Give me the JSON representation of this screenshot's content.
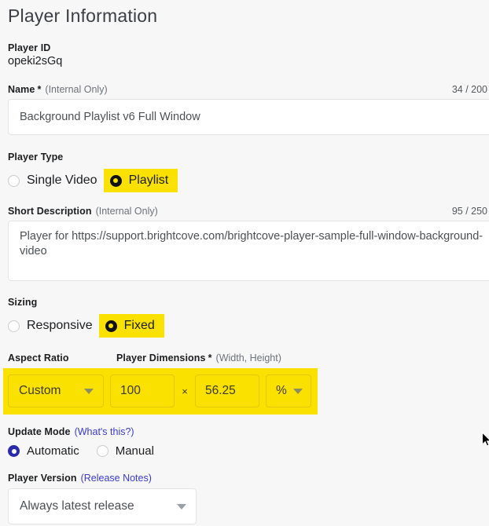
{
  "page": {
    "title": "Player Information"
  },
  "player_id": {
    "label": "Player ID",
    "value": "opeki2sGq"
  },
  "name": {
    "label": "Name",
    "required": "*",
    "sub": "(Internal Only)",
    "counter": "34 / 200",
    "value": "Background Playlist v6 Full Window"
  },
  "player_type": {
    "label": "Player Type",
    "options": [
      {
        "label": "Single Video",
        "selected": false,
        "highlighted": false
      },
      {
        "label": "Playlist",
        "selected": true,
        "highlighted": true
      }
    ]
  },
  "short_description": {
    "label": "Short Description",
    "sub": "(Internal Only)",
    "counter": "95 / 250",
    "value": "Player for https://support.brightcove.com/brightcove-player-sample-full-window-background-video"
  },
  "sizing": {
    "label": "Sizing",
    "options": [
      {
        "label": "Responsive",
        "selected": false,
        "highlighted": false
      },
      {
        "label": "Fixed",
        "selected": true,
        "highlighted": true
      }
    ]
  },
  "aspect_ratio": {
    "label": "Aspect Ratio",
    "value": "Custom"
  },
  "dimensions": {
    "label": "Player Dimensions",
    "required": "*",
    "sub": "(Width, Height)",
    "width": "100",
    "separator": "×",
    "height": "56.25",
    "unit": "%"
  },
  "update_mode": {
    "label": "Update Mode",
    "help_link": "(What's this?)",
    "options": [
      {
        "label": "Automatic",
        "selected": true
      },
      {
        "label": "Manual",
        "selected": false
      }
    ]
  },
  "player_version": {
    "label": "Player Version",
    "notes_link": "(Release Notes)",
    "value": "Always latest release"
  },
  "colors": {
    "highlight_yellow": "#fae100",
    "link_blue": "#3a3ad0",
    "radio_blue": "#2a2aad",
    "background": "#f7f7f8"
  }
}
